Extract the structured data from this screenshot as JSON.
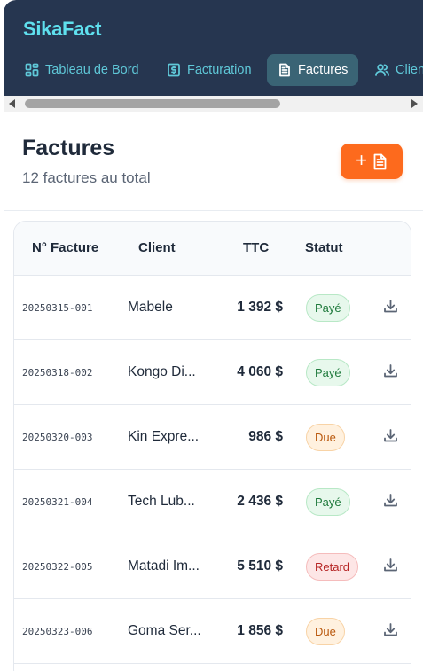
{
  "app": {
    "brand": "SikaFact"
  },
  "nav": {
    "items": [
      {
        "label": "Tableau de Bord",
        "icon": "dashboard-icon",
        "active": false
      },
      {
        "label": "Facturation",
        "icon": "dollar-doc-icon",
        "active": false
      },
      {
        "label": "Factures",
        "icon": "document-icon",
        "active": true
      },
      {
        "label": "Clients",
        "icon": "users-icon",
        "active": false
      }
    ]
  },
  "page": {
    "title": "Factures",
    "subtitle": "12 factures au total",
    "new_button": {
      "plus": "+",
      "icon": "document-plus-icon"
    }
  },
  "table": {
    "columns": [
      "N° Facture",
      "Client",
      "TTC",
      "Statut",
      ""
    ],
    "rows": [
      {
        "number": "20250315-001",
        "client": "Mabele",
        "ttc": "1 392 $",
        "status": "Payé",
        "status_kind": "paye"
      },
      {
        "number": "20250318-002",
        "client": "Kongo Di...",
        "ttc": "4 060 $",
        "status": "Payé",
        "status_kind": "paye"
      },
      {
        "number": "20250320-003",
        "client": "Kin Expre...",
        "ttc": "986 $",
        "status": "Due",
        "status_kind": "due"
      },
      {
        "number": "20250321-004",
        "client": "Tech Lub...",
        "ttc": "2 436 $",
        "status": "Payé",
        "status_kind": "paye"
      },
      {
        "number": "20250322-005",
        "client": "Matadi Im...",
        "ttc": "5 510 $",
        "status": "Retard",
        "status_kind": "retard"
      },
      {
        "number": "20250323-006",
        "client": "Goma Ser...",
        "ttc": "1 856 $",
        "status": "Due",
        "status_kind": "due"
      }
    ]
  },
  "colors": {
    "header_bg": "#263650",
    "brand": "#5fe0ee",
    "accent": "#fd6a1d",
    "paid": "#1f7a3c",
    "due": "#b9580d",
    "late": "#b62525"
  }
}
